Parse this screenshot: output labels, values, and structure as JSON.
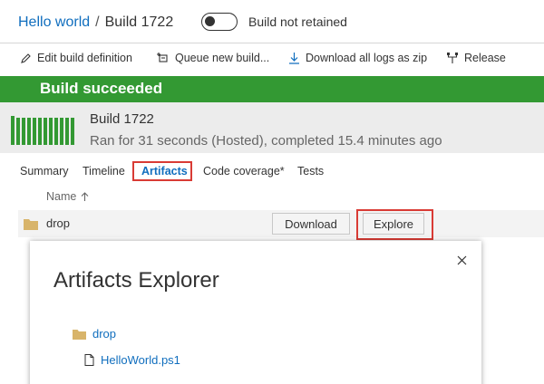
{
  "header": {
    "project": "Hello world",
    "separator": "/",
    "build": "Build 1722",
    "retain_toggle_label": "Build not retained"
  },
  "toolbar": {
    "items": [
      {
        "label": "Edit build definition",
        "icon": "pencil-icon"
      },
      {
        "label": "Queue new build...",
        "icon": "queue-icon"
      },
      {
        "label": "Download all logs as zip",
        "icon": "download-icon"
      },
      {
        "label": "Release",
        "icon": "release-icon"
      }
    ]
  },
  "status": {
    "text": "Build succeeded",
    "color": "#339933"
  },
  "summary": {
    "title": "Build 1722",
    "subtitle": "Ran for 31 seconds (Hosted), completed 15.4 minutes ago",
    "history_bar_levels": [
      0.85,
      0.8,
      0.8,
      0.8,
      0.8,
      0.8,
      0.8,
      0.8,
      0.8,
      0.8,
      0.8,
      0.8
    ]
  },
  "tabs": {
    "items": [
      "Summary",
      "Timeline",
      "Artifacts",
      "Code coverage*",
      "Tests"
    ],
    "active": "Artifacts"
  },
  "artifacts": {
    "column_header": "Name",
    "sort": "ascending",
    "rows": [
      {
        "name": "drop",
        "download_label": "Download",
        "explore_label": "Explore"
      }
    ]
  },
  "explorer": {
    "title": "Artifacts Explorer",
    "folder": "drop",
    "file": "HelloWorld.ps1"
  },
  "colors": {
    "link": "#106ebe",
    "success": "#339933",
    "highlight": "#d93b35",
    "folder": "#d8b46a"
  }
}
